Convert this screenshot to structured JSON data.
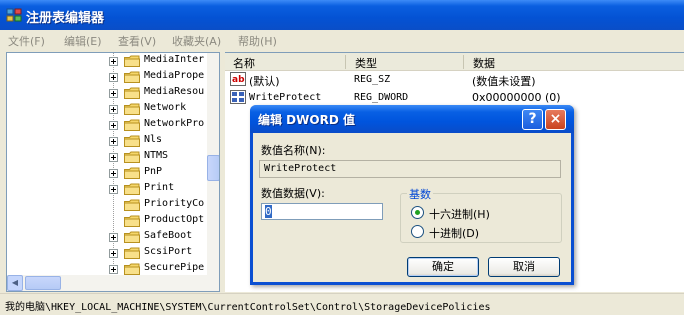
{
  "window": {
    "title": "注册表编辑器"
  },
  "menu": [
    "文件(F)",
    "编辑(E)",
    "查看(V)",
    "收藏夹(A)",
    "帮助(H)"
  ],
  "tree": {
    "items": [
      "MediaInter",
      "MediaPrope",
      "MediaResou",
      "Network",
      "NetworkPro",
      "Nls",
      "NTMS",
      "PnP",
      "Print",
      "PriorityCo",
      "ProductOpt",
      "SafeBoot",
      "ScsiPort",
      "SecurePipe"
    ]
  },
  "list": {
    "columns": [
      "名称",
      "类型",
      "数据"
    ],
    "rows": [
      {
        "icon": "string-value-icon",
        "name": "(默认)",
        "type": "REG_SZ",
        "data": "(数值未设置)"
      },
      {
        "icon": "binary-value-icon",
        "name": "WriteProtect",
        "type": "REG_DWORD",
        "data": "0x00000000 (0)"
      }
    ]
  },
  "status": {
    "path": "我的电脑\\HKEY_LOCAL_MACHINE\\SYSTEM\\CurrentControlSet\\Control\\StorageDevicePolicies"
  },
  "dialog": {
    "title": "编辑 DWORD 值",
    "help_glyph": "?",
    "close_glyph": "×",
    "name_label": "数值名称(N):",
    "name_value": "WriteProtect",
    "data_label": "数值数据(V):",
    "data_value": "0",
    "base_label": "基数",
    "radio_hex": "十六进制(H)",
    "radio_dec": "十进制(D)",
    "selected_base": "hex",
    "ok_label": "确定",
    "cancel_label": "取消"
  },
  "colors": {
    "titlebar": "#0a5fe0",
    "selection": "#316ac5",
    "group_label": "#0046d5"
  }
}
